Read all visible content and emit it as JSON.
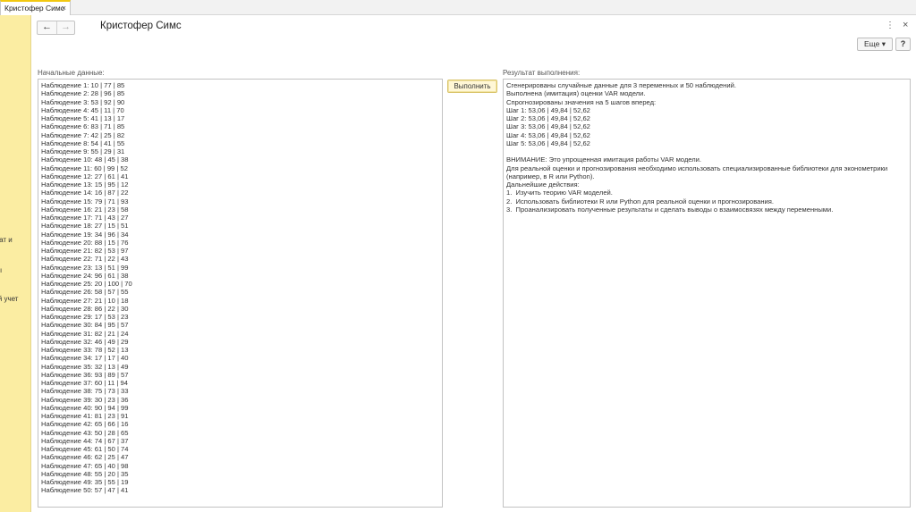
{
  "tab": {
    "title": "Кристофер Симс",
    "close": "×"
  },
  "sidebar": {
    "items": [
      "ьтат и",
      "вы",
      "ый учет",
      "е"
    ]
  },
  "header": {
    "back": "←",
    "forward": "→",
    "title": "Кристофер Симс",
    "more_dots": "⋮",
    "close": "×"
  },
  "toolbar": {
    "more_label": "Еще ▾",
    "help_label": "?"
  },
  "input": {
    "label": "Начальные данные:",
    "lines": [
      "Наблюдение 1: 10 | 77 | 85",
      "Наблюдение 2: 28 | 96 | 85",
      "Наблюдение 3: 53 | 92 | 90",
      "Наблюдение 4: 45 | 11 | 70",
      "Наблюдение 5: 41 | 13 | 17",
      "Наблюдение 6: 83 | 71 | 85",
      "Наблюдение 7: 42 | 25 | 82",
      "Наблюдение 8: 54 | 41 | 55",
      "Наблюдение 9: 55 | 29 | 31",
      "Наблюдение 10: 48 | 45 | 38",
      "Наблюдение 11: 60 | 99 | 52",
      "Наблюдение 12: 27 | 61 | 41",
      "Наблюдение 13: 15 | 95 | 12",
      "Наблюдение 14: 16 | 87 | 22",
      "Наблюдение 15: 79 | 71 | 93",
      "Наблюдение 16: 21 | 23 | 58",
      "Наблюдение 17: 71 | 43 | 27",
      "Наблюдение 18: 27 | 15 | 51",
      "Наблюдение 19: 34 | 96 | 34",
      "Наблюдение 20: 88 | 15 | 76",
      "Наблюдение 21: 82 | 53 | 97",
      "Наблюдение 22: 71 | 22 | 43",
      "Наблюдение 23: 13 | 51 | 99",
      "Наблюдение 24: 96 | 61 | 38",
      "Наблюдение 25: 20 | 100 | 70",
      "Наблюдение 26: 58 | 57 | 55",
      "Наблюдение 27: 21 | 10 | 18",
      "Наблюдение 28: 86 | 22 | 30",
      "Наблюдение 29: 17 | 53 | 23",
      "Наблюдение 30: 84 | 95 | 57",
      "Наблюдение 31: 82 | 21 | 24",
      "Наблюдение 32: 46 | 49 | 29",
      "Наблюдение 33: 78 | 52 | 13",
      "Наблюдение 34: 17 | 17 | 40",
      "Наблюдение 35: 32 | 13 | 49",
      "Наблюдение 36: 93 | 89 | 57",
      "Наблюдение 37: 60 | 11 | 94",
      "Наблюдение 38: 75 | 73 | 33",
      "Наблюдение 39: 30 | 23 | 36",
      "Наблюдение 40: 90 | 94 | 99",
      "Наблюдение 41: 81 | 23 | 91",
      "Наблюдение 42: 65 | 66 | 16",
      "Наблюдение 43: 50 | 28 | 65",
      "Наблюдение 44: 74 | 67 | 37",
      "Наблюдение 45: 61 | 50 | 74",
      "Наблюдение 46: 62 | 25 | 47",
      "Наблюдение 47: 65 | 40 | 98",
      "Наблюдение 48: 55 | 20 | 35",
      "Наблюдение 49: 35 | 55 | 19",
      "Наблюдение 50: 57 | 47 | 41"
    ]
  },
  "run_button": {
    "label": "Выполнить"
  },
  "result": {
    "label": "Результат выполнения:",
    "lines": [
      "Сгенерированы случайные данные для 3 переменных и 50 наблюдений.",
      "Выполнена (имитация) оценки VAR модели.",
      "Спрогнозированы значения на 5 шагов вперед:",
      "Шаг 1: 53,06 | 49,84 | 52,62",
      "Шаг 2: 53,06 | 49,84 | 52,62",
      "Шаг 3: 53,06 | 49,84 | 52,62",
      "Шаг 4: 53,06 | 49,84 | 52,62",
      "Шаг 5: 53,06 | 49,84 | 52,62",
      "",
      "ВНИМАНИЕ: Это упрощенная имитация работы VAR модели.",
      "Для реальной оценки и прогнозирования необходимо использовать специализированные библиотеки для эконометрики",
      "(например, в R или Python).",
      "Дальнейшие действия:",
      "1.  Изучить теорию VAR моделей.",
      "2.  Использовать библиотеки R или Python для реальной оценки и прогнозирования.",
      "3.  Проанализировать полученные результаты и сделать выводы о взаимосвязях между переменными."
    ]
  }
}
